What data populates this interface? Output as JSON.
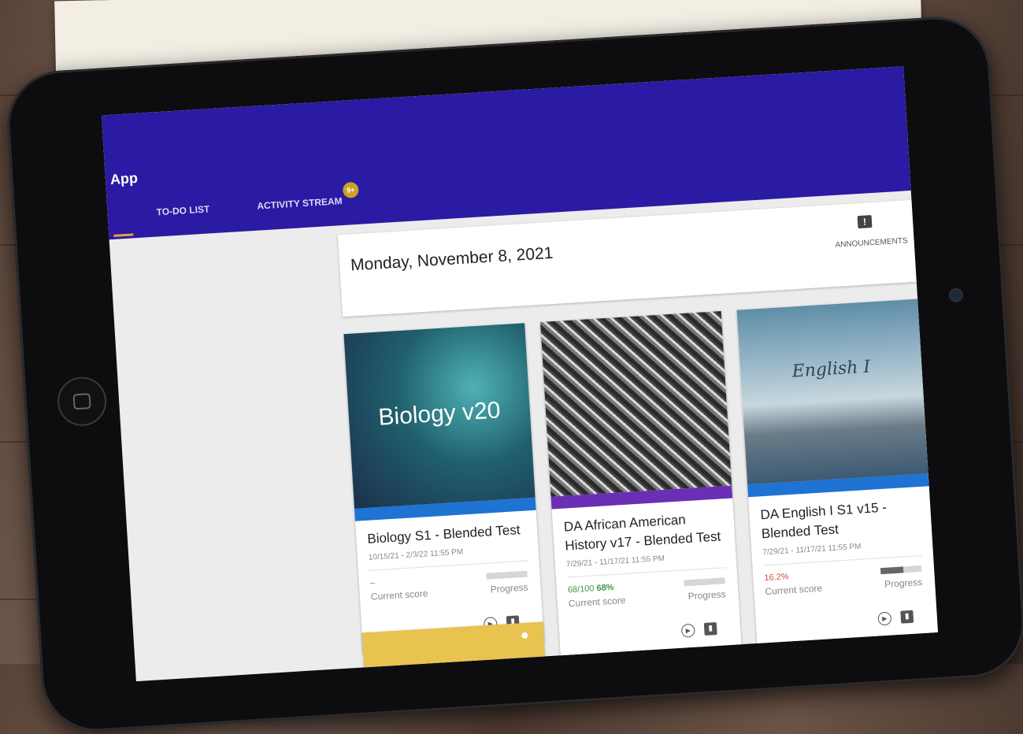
{
  "app": {
    "title": "App",
    "tabs": [
      {
        "label": "TO-DO LIST",
        "active": true
      },
      {
        "label": "ACTIVITY STREAM",
        "badge": "9+"
      }
    ]
  },
  "header": {
    "date": "Monday, November 8, 2021",
    "announcements_label": "ANNOUNCEMENTS",
    "announcements_icon": "announcement-icon"
  },
  "courses": [
    {
      "cover_text": "Biology v20",
      "title": "Biology S1 - Blended Test",
      "dates": "10/15/21 - 2/3/22 11:55 PM",
      "score_value": "–",
      "score_label": "Current score",
      "progress_label": "Progress",
      "progress": 0,
      "accent": "#1e73d3"
    },
    {
      "cover_text": "",
      "title": "DA African American History v17 - Blended Test",
      "dates": "7/29/21 - 11/17/21 11:55 PM",
      "score_fraction": "68/100",
      "score_percent": "68%",
      "score_label": "Current score",
      "progress_label": "Progress",
      "progress": 0,
      "accent": "#6a2fb5"
    },
    {
      "cover_text": "English I",
      "title": "DA English I S1 v15 - Blended Test",
      "dates": "7/29/21 - 11/17/21 11:55 PM",
      "score_value": "16.2%",
      "score_label": "Current score",
      "progress_label": "Progress",
      "progress": 0.55,
      "accent": "#1e73d3"
    }
  ],
  "colors": {
    "appbar": "#2b1aa3",
    "badge": "#c9a227",
    "score_good": "#3a9b46",
    "score_low": "#d44d3d",
    "yellow_card": "#e8c350"
  }
}
